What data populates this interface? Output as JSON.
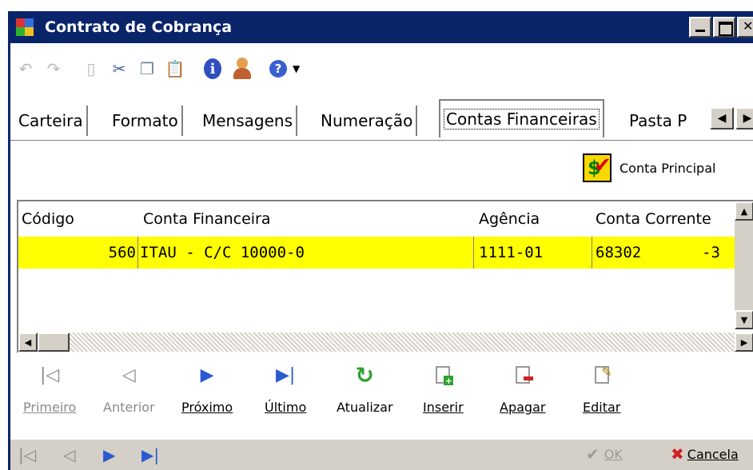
{
  "window": {
    "title": "Contrato de Cobrança"
  },
  "tabs": [
    "Carteira",
    "Formato",
    "Mensagens",
    "Numeração",
    "Contas Financeiras",
    "Pasta P"
  ],
  "principal": {
    "label": "Conta Principal"
  },
  "grid": {
    "columns": [
      "Código",
      "Conta Financeira",
      "Agência",
      "Conta Corrente"
    ],
    "rows": [
      {
        "codigo": "560",
        "conta": "ITAU - C/C 10000-0",
        "agencia": "1111-01",
        "corrente": "68302",
        "digito": "-3"
      }
    ]
  },
  "nav": {
    "primeiro": "Primeiro",
    "anterior": "Anterior",
    "proximo": "Próximo",
    "ultimo": "Último",
    "atualizar": "Atualizar",
    "inserir": "Inserir",
    "apagar": "Apagar",
    "editar": "Editar"
  },
  "footer": {
    "ok": "OK",
    "cancel": "Cancela"
  },
  "colors": {
    "titlebar": "#0a246a",
    "selected_row": "#ffff00",
    "nav_blue": "#2a5ad0",
    "refresh_green": "#2ea02e"
  }
}
